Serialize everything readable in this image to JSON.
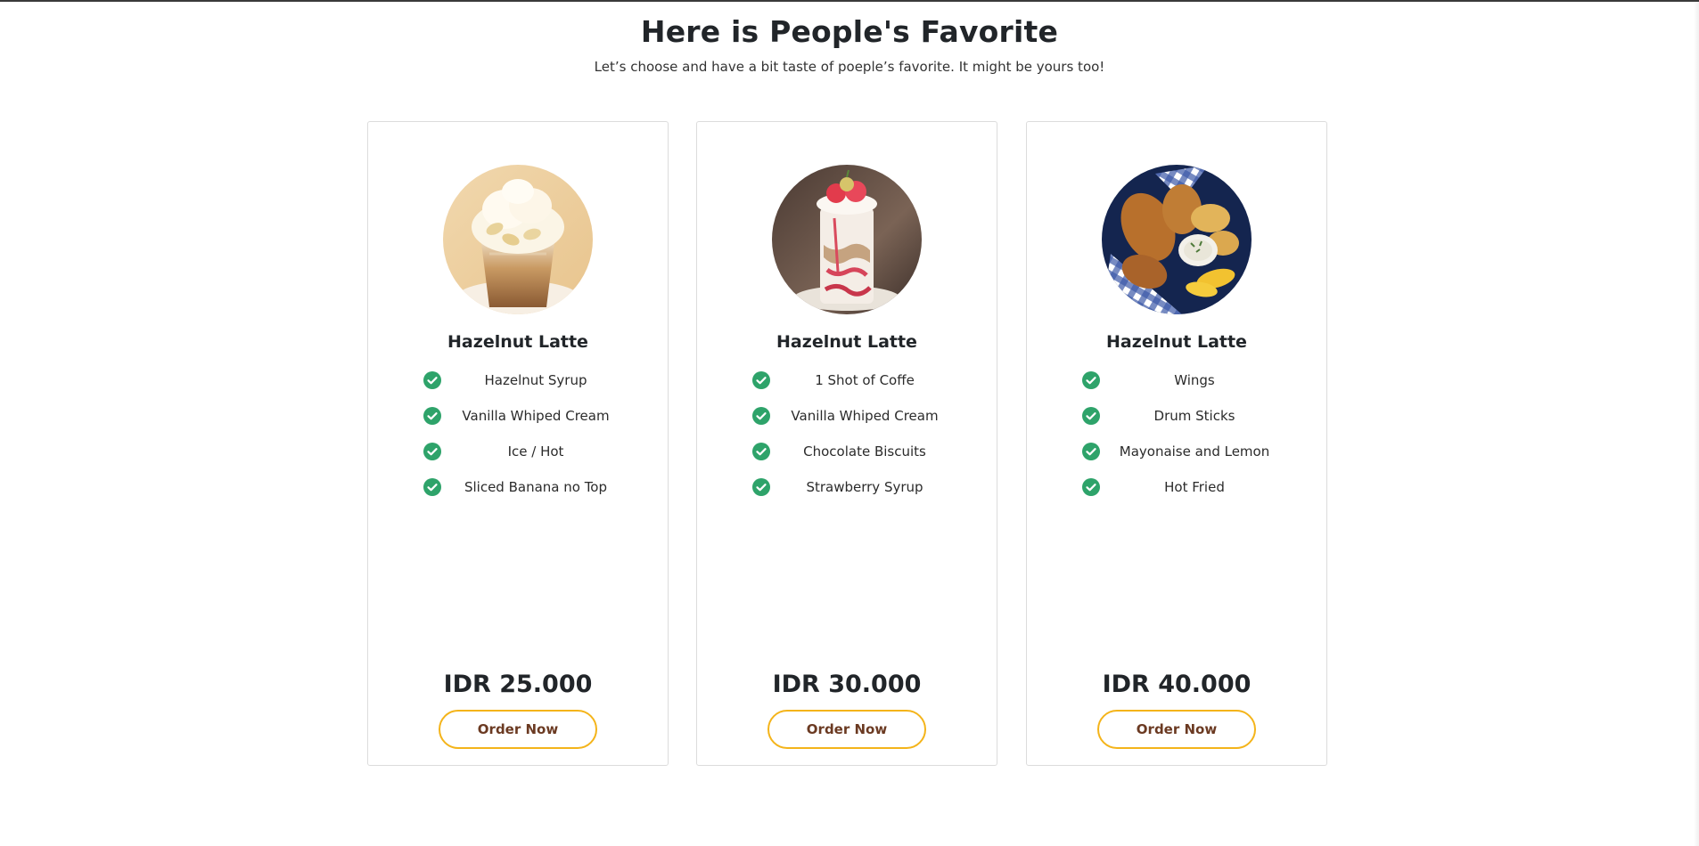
{
  "section": {
    "title": "Here is People's Favorite",
    "subtitle": "Let’s choose and have a bit taste of poeple’s favorite. It might be yours too!"
  },
  "colors": {
    "check": "#2ea36a",
    "button_border": "#f4b41a",
    "button_text": "#6b3a22"
  },
  "cards": [
    {
      "image": "banana-hazelnut-latte-photo",
      "title": "Hazelnut Latte",
      "features": [
        "Hazelnut Syrup",
        "Vanilla Whiped Cream",
        "Ice / Hot",
        "Sliced Banana no Top"
      ],
      "price": "IDR 25.000",
      "button": "Order Now"
    },
    {
      "image": "strawberry-shake-photo",
      "title": "Hazelnut Latte",
      "features": [
        "1 Shot of Coffe",
        "Vanilla Whiped Cream",
        "Chocolate Biscuits",
        "Strawberry Syrup"
      ],
      "price": "IDR 30.000",
      "button": "Order Now"
    },
    {
      "image": "fried-chicken-wings-photo",
      "title": "Hazelnut Latte",
      "features": [
        "Wings",
        "Drum Sticks",
        "Mayonaise and Lemon",
        "Hot Fried"
      ],
      "price": "IDR 40.000",
      "button": "Order Now"
    }
  ]
}
